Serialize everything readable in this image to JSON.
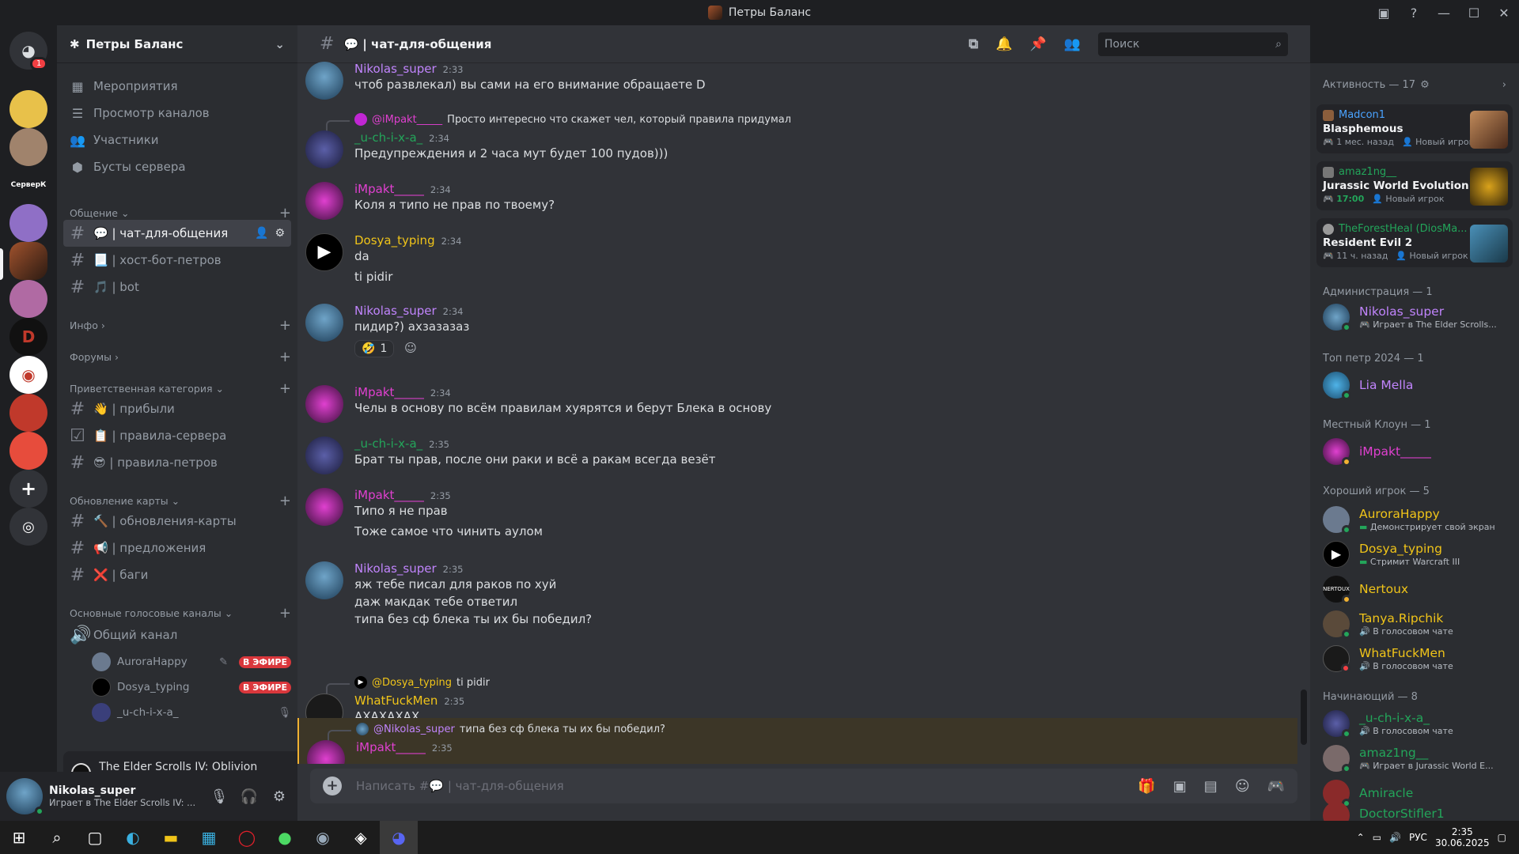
{
  "window": {
    "title": "Петры Баланс"
  },
  "server": {
    "name": "Петры Баланс",
    "rail_label": "СерверК",
    "notif_count": "1"
  },
  "nav": [
    {
      "label": "Мероприятия",
      "icon": "calendar-icon",
      "glyph": "▦"
    },
    {
      "label": "Просмотр каналов",
      "icon": "browse-channels-icon",
      "glyph": "☰"
    },
    {
      "label": "Участники",
      "icon": "members-icon",
      "glyph": "👥"
    },
    {
      "label": "Бусты сервера",
      "icon": "boost-icon",
      "glyph": "⬢"
    }
  ],
  "categories": {
    "obshenie": "Общение",
    "info": "Инфо",
    "forums": "Форумы",
    "welcome": "Приветственная категория",
    "map": "Обновление карты",
    "voice": "Основные голосовые каналы"
  },
  "channels": {
    "chat": "💬 | чат-для-общения",
    "host": "📃 | хост-бот-петров",
    "bot": "🎵 | bot",
    "arrived": "👋 | прибыли",
    "rules_server": "📋 | правила-сервера",
    "rules_petrov": "😎 | правила-петров",
    "map_updates": "🔨 | обновления-карты",
    "suggestions": "📢 | предложения",
    "bugs": "❌ | баги",
    "voice_general": "Общий канал"
  },
  "voice_users": [
    {
      "name": "AuroraHappy",
      "badge": "В ЭФИРЕ"
    },
    {
      "name": "Dosya_typing",
      "badge": "В ЭФИРЕ"
    },
    {
      "name": "_u-ch-i-x-a_",
      "badge": ""
    }
  ],
  "game_bar": {
    "title": "The Elder Scrolls IV: Oblivion Remastered"
  },
  "user_panel": {
    "name": "Nikolas_super",
    "status": "Играет в The Elder Scrolls IV: ..."
  },
  "header": {
    "channel": "💬 | чат-для-общения",
    "search_placeholder": "Поиск"
  },
  "messages": [
    {
      "user": "Nikolas_super",
      "time": "2:33",
      "color": "#c084fc",
      "lines": [
        "чтоб развлекал) вы сами на его внимание обращаете D"
      ]
    },
    {
      "reply_to": "@iMpakt_____",
      "reply_text": "Просто интересно что скажет чел, который правила придумал",
      "user": "_u-ch-i-x-a_",
      "time": "2:34",
      "color": "#23a55a",
      "lines": [
        "Предупреждения и 2 часа мут будет 100 пудов)))"
      ]
    },
    {
      "user": "iMpakt_____",
      "time": "2:34",
      "color": "#e040d0",
      "lines": [
        "Коля я типо не прав по твоему?"
      ]
    },
    {
      "user": "Dosya_typing",
      "time": "2:34",
      "color": "#f0c419",
      "lines": [
        "da",
        "ti pidir"
      ]
    },
    {
      "user": "Nikolas_super",
      "time": "2:34",
      "color": "#c084fc",
      "lines": [
        "пидир?) ахзазазаз"
      ],
      "reaction": {
        "emoji": "🤣",
        "count": "1"
      }
    },
    {
      "user": "iMpakt_____",
      "time": "2:34",
      "color": "#e040d0",
      "lines": [
        "Челы в основу по всём правилам хуярятся и берут Блека в основу"
      ]
    },
    {
      "user": "_u-ch-i-x-a_",
      "time": "2:35",
      "color": "#23a55a",
      "lines": [
        "Брат ты прав, после они раки и всё а ракам всегда везёт"
      ]
    },
    {
      "user": "iMpakt_____",
      "time": "2:35",
      "color": "#e040d0",
      "lines": [
        "Типо я не прав",
        "Тоже самое что чинить аулом"
      ]
    },
    {
      "user": "Nikolas_super",
      "time": "2:35",
      "color": "#c084fc",
      "lines": [
        "яж тебе писал для раков по хуй",
        "даж макдак тебе ответил",
        "типа без сф блека ты их бы победил?"
      ]
    },
    {
      "reply_to": "@Dosya_typing",
      "reply_text": "ti pidir",
      "user": "WhatFuckMen",
      "time": "2:35",
      "color": "#f0c419",
      "lines": [
        "АХАХАХАХ"
      ]
    },
    {
      "reply_to": "@Nikolas_super",
      "reply_text": "типа без сф блека ты их бы победил?",
      "user": "iMpakt_____",
      "time": "2:35",
      "color": "#e040d0",
      "lines": []
    }
  ],
  "composer": {
    "placeholder": "Написать #💬 | чат-для-общения"
  },
  "members": {
    "activity_header": "Активность — 17",
    "activities": [
      {
        "user": "Madcon1",
        "game": "Blasphemous",
        "meta1": "1 мес. назад",
        "meta2": "Новый игрок",
        "color": "#4aa3ff"
      },
      {
        "user": "amaz1ng__",
        "game": "Jurassic World Evolution 2",
        "meta1": "17:00",
        "meta2": "Новый игрок",
        "color": "#23a55a"
      },
      {
        "user": "TheForestHeal (DiosMa...",
        "game": "Resident Evil 2",
        "meta1": "11 ч. назад",
        "meta2": "Новый игрок",
        "color": "#23a55a"
      }
    ],
    "groups": [
      {
        "title": "Администрация — 1",
        "items": [
          {
            "name": "Nikolas_super",
            "status": "Играет в The Elder Scrolls...",
            "color": "#c084fc"
          }
        ]
      },
      {
        "title": "Топ петр 2024 — 1",
        "items": [
          {
            "name": "Lia Mella",
            "status": "",
            "color": "#c084fc"
          }
        ]
      },
      {
        "title": "Местный Клоун — 1",
        "items": [
          {
            "name": "iMpakt_____",
            "status": "",
            "color": "#e040d0"
          }
        ]
      },
      {
        "title": "Хороший игрок — 5",
        "items": [
          {
            "name": "AuroraHappy",
            "status": "Демонстрирует свой экран",
            "color": "#f0c419"
          },
          {
            "name": "Dosya_typing",
            "status": "Стримит Warcraft III",
            "color": "#f0c419"
          },
          {
            "name": "Nertoux",
            "status": "",
            "color": "#f0c419"
          },
          {
            "name": "Tanya.Ripchik",
            "status": "В голосовом чате",
            "color": "#f0c419"
          },
          {
            "name": "WhatFuckMen",
            "status": "В голосовом чате",
            "color": "#f0c419"
          }
        ]
      },
      {
        "title": "Начинающий — 8",
        "items": [
          {
            "name": "_u-ch-i-x-a_",
            "status": "В голосовом чате",
            "color": "#23a55a"
          },
          {
            "name": "amaz1ng__",
            "status": "Играет в Jurassic World E...",
            "color": "#23a55a"
          },
          {
            "name": "Amiracle",
            "status": "",
            "color": "#23a55a"
          },
          {
            "name": "DoctorStifler1",
            "status": "",
            "color": "#23a55a"
          }
        ]
      }
    ]
  },
  "taskbar": {
    "lang": "РУС",
    "time": "2:35",
    "date": "30.06.2025"
  }
}
